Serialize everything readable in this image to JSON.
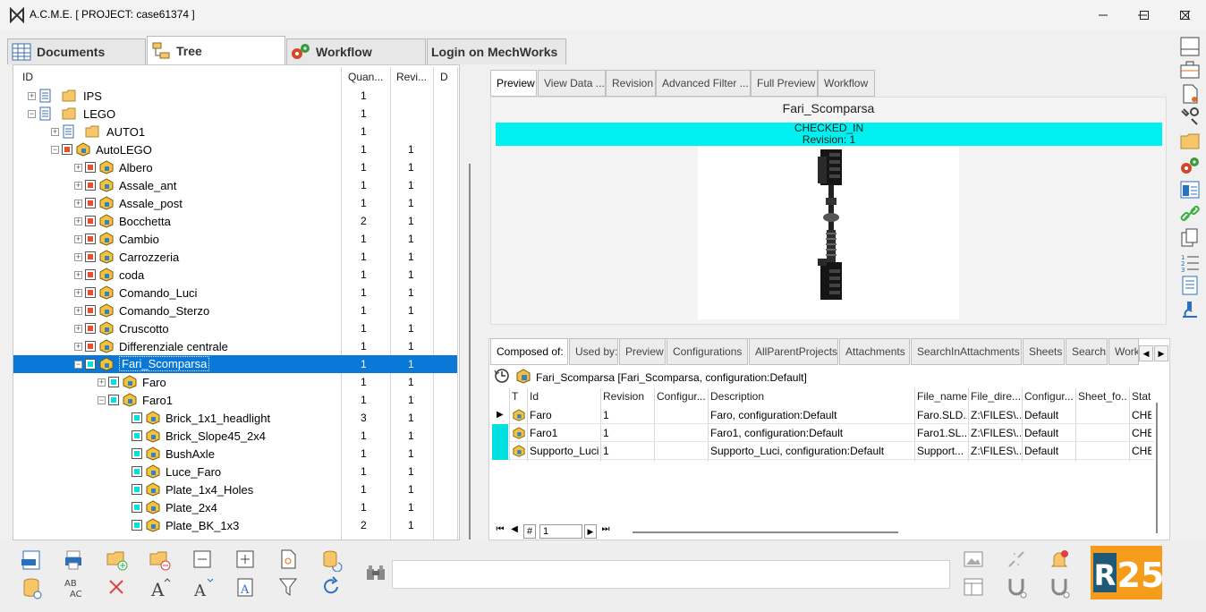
{
  "window": {
    "title": "A.C.M.E. [ PROJECT: case61374 ]"
  },
  "main_tabs": [
    {
      "label": "Documents"
    },
    {
      "label": "Tree"
    },
    {
      "label": "Workflow"
    },
    {
      "label": "Login on MechWorks"
    }
  ],
  "tree": {
    "headers": {
      "id": "ID",
      "qty": "Quan...",
      "rev": "Revi...",
      "d": "D"
    },
    "rows": [
      {
        "name": "IPS",
        "qty": "1",
        "rev": ""
      },
      {
        "name": "LEGO",
        "qty": "1",
        "rev": ""
      },
      {
        "name": "AUTO1",
        "qty": "1",
        "rev": ""
      },
      {
        "name": "AutoLEGO",
        "qty": "1",
        "rev": "1"
      },
      {
        "name": "Albero",
        "qty": "1",
        "rev": "1"
      },
      {
        "name": "Assale_ant",
        "qty": "1",
        "rev": "1"
      },
      {
        "name": "Assale_post",
        "qty": "1",
        "rev": "1"
      },
      {
        "name": "Bocchetta",
        "qty": "2",
        "rev": "1"
      },
      {
        "name": "Cambio",
        "qty": "1",
        "rev": "1"
      },
      {
        "name": "Carrozzeria",
        "qty": "1",
        "rev": "1"
      },
      {
        "name": "coda",
        "qty": "1",
        "rev": "1"
      },
      {
        "name": "Comando_Luci",
        "qty": "1",
        "rev": "1"
      },
      {
        "name": "Comando_Sterzo",
        "qty": "1",
        "rev": "1"
      },
      {
        "name": "Cruscotto",
        "qty": "1",
        "rev": "1"
      },
      {
        "name": "Differenziale centrale",
        "qty": "1",
        "rev": "1"
      },
      {
        "name": "Fari_Scomparsa",
        "qty": "1",
        "rev": "1"
      },
      {
        "name": "Faro",
        "qty": "1",
        "rev": "1"
      },
      {
        "name": "Faro1",
        "qty": "1",
        "rev": "1"
      },
      {
        "name": "Brick_1x1_headlight",
        "qty": "3",
        "rev": "1"
      },
      {
        "name": "Brick_Slope45_2x4",
        "qty": "1",
        "rev": "1"
      },
      {
        "name": "BushAxle",
        "qty": "1",
        "rev": "1"
      },
      {
        "name": "Luce_Faro",
        "qty": "1",
        "rev": "1"
      },
      {
        "name": "Plate_1x4_Holes",
        "qty": "1",
        "rev": "1"
      },
      {
        "name": "Plate_2x4",
        "qty": "1",
        "rev": "1"
      },
      {
        "name": "Plate_BK_1x3",
        "qty": "2",
        "rev": "1"
      }
    ]
  },
  "preview_tabs": [
    {
      "label": "Preview"
    },
    {
      "label": "View Data ..."
    },
    {
      "label": "Revision"
    },
    {
      "label": "Advanced Filter ..."
    },
    {
      "label": "Full Preview"
    },
    {
      "label": "Workflow"
    }
  ],
  "preview": {
    "title": "Fari_Scomparsa",
    "status": "CHECKED_IN",
    "revision": "Revision: 1",
    "status_color": "#00f0f0"
  },
  "lower_tabs": [
    {
      "label": "Composed of:"
    },
    {
      "label": "Used by:"
    },
    {
      "label": "Preview"
    },
    {
      "label": "Configurations"
    },
    {
      "label": "AllParentProjects"
    },
    {
      "label": "Attachments"
    },
    {
      "label": "SearchInAttachments"
    },
    {
      "label": "Sheets"
    },
    {
      "label": "Search"
    },
    {
      "label": "Work"
    }
  ],
  "composed": {
    "caption": "Fari_Scomparsa [Fari_Scomparsa, configuration:Default]",
    "headers": {
      "t": "T",
      "id": "Id",
      "revision": "Revision",
      "configuration": "Configur...",
      "description": "Description",
      "file_name": "File_name",
      "file_dir": "File_dire...",
      "config2": "Configur...",
      "sheet": "Sheet_fo...",
      "status": "Stat"
    },
    "rows": [
      {
        "id": "Faro",
        "revision": "1",
        "description": "Faro, configuration:Default",
        "file_name": "Faro.SLD...",
        "file_dir": "Z:\\FILES\\...",
        "config2": "Default",
        "status": "CHE"
      },
      {
        "id": "Faro1",
        "revision": "1",
        "description": "Faro1, configuration:Default",
        "file_name": "Faro1.SL...",
        "file_dir": "Z:\\FILES\\...",
        "config2": "Default",
        "status": "CHE"
      },
      {
        "id": "Supporto_Luci",
        "revision": "1",
        "description": "Supporto_Luci, configuration:Default",
        "file_name": "Support...",
        "file_dir": "Z:\\FILES\\...",
        "config2": "Default",
        "status": "CHE"
      }
    ],
    "pager": {
      "hash": "#",
      "page": "1"
    }
  },
  "bottom": {
    "search_value": ""
  },
  "badge": {
    "text": "R25",
    "color": "#f59c1a"
  },
  "colors": {
    "selection": "#0a78d7",
    "accent_red": "#f04a2a",
    "accent_cyan": "#00e0e0",
    "folder": "#f7c66b"
  }
}
